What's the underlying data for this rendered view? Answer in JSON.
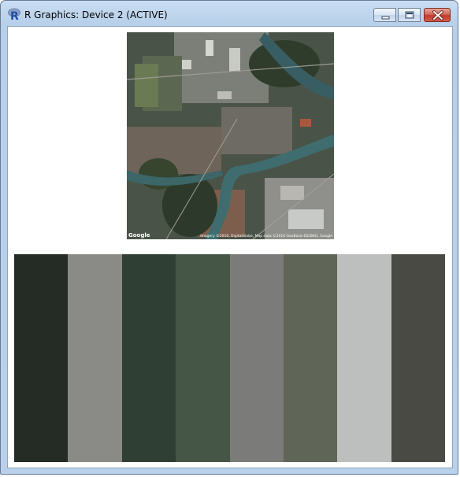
{
  "window": {
    "title": "R Graphics: Device 2 (ACTIVE)",
    "icon": "r-logo-icon",
    "controls": [
      "minimize-icon",
      "maximize-icon",
      "close-icon"
    ]
  },
  "map": {
    "logo_text": "Google",
    "copyright": "Imagery ©2016, DigitalGlobe, Map data ©2016 GeoBasis-DE/BKG, Google"
  },
  "palette": {
    "colors": [
      "#242c25",
      "#8a8b86",
      "#2f3f33",
      "#465646",
      "#7b7c79",
      "#5f6658",
      "#bdbfbf",
      "#4a4a44"
    ]
  }
}
